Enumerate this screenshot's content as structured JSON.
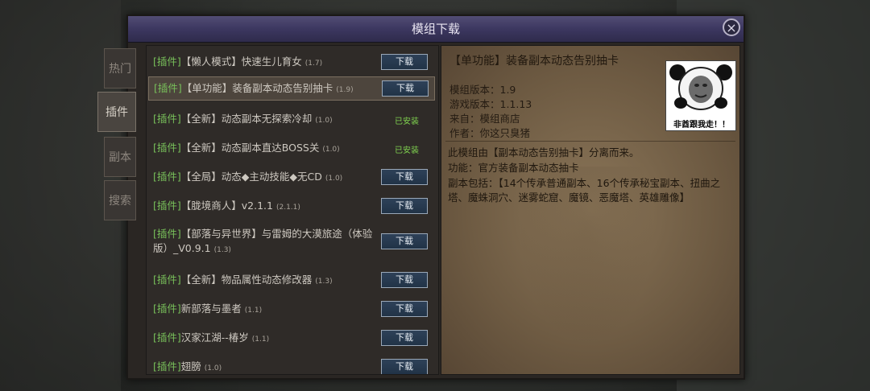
{
  "window": {
    "title": "模组下载",
    "close_icon": "×"
  },
  "tabs": [
    {
      "label": "热门",
      "active": false
    },
    {
      "label": "插件",
      "active": true
    },
    {
      "label": "副本",
      "active": false
    },
    {
      "label": "搜索",
      "active": false
    }
  ],
  "download_label": "下载",
  "installed_label": "已安装",
  "mods": [
    {
      "tag": "[插件]",
      "name": "【懒人模式】快速生儿育女",
      "version": "(1.7)",
      "status": "download"
    },
    {
      "tag": "[插件]",
      "name": "【单功能】装备副本动态告别抽卡",
      "version": "(1.9)",
      "status": "download",
      "selected": true
    },
    {
      "tag": "[插件]",
      "name": "【全新】动态副本无探索冷却",
      "version": "(1.0)",
      "status": "installed"
    },
    {
      "tag": "[插件]",
      "name": "【全新】动态副本直达BOSS关",
      "version": "(1.0)",
      "status": "installed"
    },
    {
      "tag": "[插件]",
      "name": "【全局】动态◆主动技能◆无CD",
      "version": "(1.0)",
      "status": "download"
    },
    {
      "tag": "[插件]",
      "name": "【胧境商人】v2.1.1",
      "version": "(2.1.1)",
      "status": "download"
    },
    {
      "tag": "[插件]",
      "name": "【部落与异世界】与雷姆的大漠旅途（体验版）_V0.9.1",
      "version": "(1.3)",
      "status": "download"
    },
    {
      "tag": "[插件]",
      "name": "【全新】物品属性动态修改器",
      "version": "(1.3)",
      "status": "download"
    },
    {
      "tag": "[插件]",
      "name": "新部落与墨者",
      "version": "(1.1)",
      "status": "download"
    },
    {
      "tag": "[插件]",
      "name": "汉家江湖--椿岁",
      "version": "(1.1)",
      "status": "download"
    },
    {
      "tag": "[插件]",
      "name": "翅膀",
      "version": "(1.0)",
      "status": "download"
    }
  ],
  "detail": {
    "title": "【单功能】装备副本动态告别抽卡",
    "mod_version": "模组版本：1.9",
    "game_version": "游戏版本：1.1.13",
    "source": "来自：模组商店",
    "author": "作者：你这只臭猪",
    "thumbnail_caption": "非酋跟我走！！",
    "description": [
      "此模组由【副本动态告别抽卡】分离而来。",
      "功能：官方装备副本动态抽卡",
      "副本包括：【14个传承普通副本、16个传承秘宝副本、扭曲之塔、魔蛛洞穴、迷雾蛇窟、魔镜、恶魔塔、英雄雕像】"
    ]
  },
  "colors": {
    "tag_green": "#78c05a",
    "installed_green": "#7fd14f",
    "title_bar": "#3c3760",
    "detail_bg": "#7b684d"
  }
}
